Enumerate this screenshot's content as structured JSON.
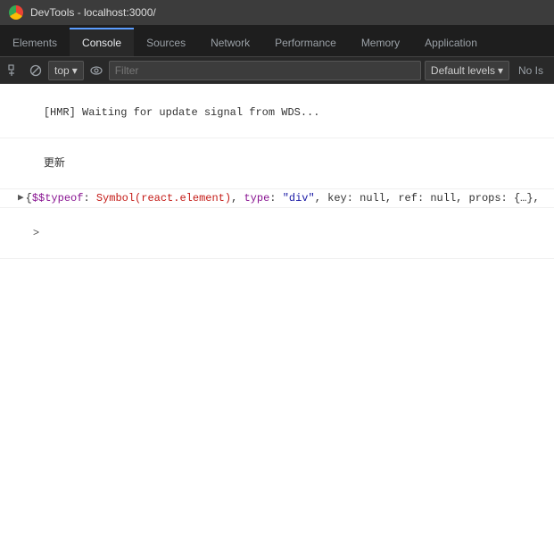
{
  "titlebar": {
    "icon": "chrome-icon",
    "title": "DevTools - localhost:3000/"
  },
  "tabs": [
    {
      "label": "Elements",
      "active": false
    },
    {
      "label": "Console",
      "active": true
    },
    {
      "label": "Sources",
      "active": false
    },
    {
      "label": "Network",
      "active": false
    },
    {
      "label": "Performance",
      "active": false
    },
    {
      "label": "Memory",
      "active": false
    },
    {
      "label": "Application",
      "active": false
    }
  ],
  "toolbar": {
    "context": "top",
    "filter_placeholder": "Filter",
    "default_levels_label": "Default levels",
    "no_issues_label": "No Is"
  },
  "console": {
    "lines": [
      {
        "type": "info",
        "text": "[HMR] Waiting for update signal from WDS..."
      },
      {
        "type": "update",
        "text": "更新"
      },
      {
        "type": "object",
        "prefix": "▶",
        "text_before": "{$$typeof: ",
        "symbol_text": "Symbol(react.element)",
        "text_middle": ", type: ",
        "string_text": "\"div\"",
        "text_after": ", key: null, ref: null, props: {…},"
      }
    ],
    "arrow": ">"
  }
}
